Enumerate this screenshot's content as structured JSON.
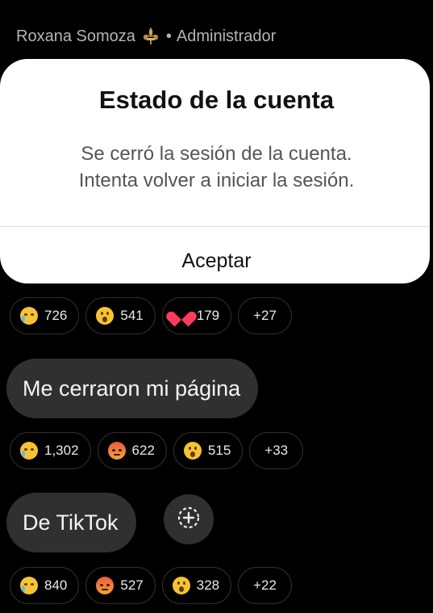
{
  "header": {
    "name": "Roxana Somoza",
    "separator": "•",
    "role": "Administrador"
  },
  "dialog": {
    "title": "Estado de la cuenta",
    "message_line1": "Se cerró la sesión de la cuenta.",
    "message_line2": "Intenta volver a iniciar la sesión.",
    "button": "Aceptar"
  },
  "reactions_1": {
    "sad": "726",
    "wow": "541",
    "love": "179",
    "more": "+27"
  },
  "message_1": "Me cerraron mi página",
  "reactions_2": {
    "sad": "1,302",
    "angry": "622",
    "wow": "515",
    "more": "+33"
  },
  "message_2": "De TikTok",
  "reactions_3": {
    "sad": "840",
    "angry": "527",
    "wow": "328",
    "more": "+22"
  },
  "icons": [
    "fleur-de-lis-icon",
    "sad-emoji-icon",
    "wow-emoji-icon",
    "heart-icon",
    "angry-emoji-icon",
    "add-reaction-icon"
  ],
  "colors": {
    "background": "#000000",
    "dialog": "#ffffff",
    "bubble": "#303030",
    "pill_border": "#2f2f2f"
  }
}
